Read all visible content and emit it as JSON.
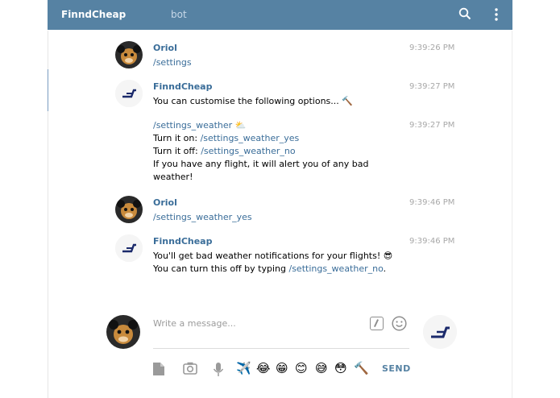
{
  "header": {
    "title": "FinndCheap",
    "subtitle": "bot",
    "search_icon": "search-icon",
    "more_icon": "more-vertical-icon",
    "color": "#5682a3"
  },
  "messages": [
    {
      "author": "Oriol",
      "time": "9:39:26 PM",
      "lines": [
        "/settings"
      ]
    },
    {
      "author": "FinndCheap",
      "time": "9:39:27 PM",
      "text": "You can customise the following options...",
      "emoji": "🔨"
    },
    {
      "time": "9:39:27 PM",
      "command": "/settings_weather",
      "command_emoji": "⛅",
      "turn_on_label": "Turn it on:",
      "turn_on_cmd": "/settings_weather_yes",
      "turn_off_label": "Turn it off:",
      "turn_off_cmd": "/settings_weather_no",
      "note_line1": "If you have any flight, it will alert you of any bad",
      "note_line2": "weather!"
    },
    {
      "author": "Oriol",
      "time": "9:39:46 PM",
      "lines": [
        "/settings_weather_yes"
      ]
    },
    {
      "author": "FinndCheap",
      "time": "9:39:46 PM",
      "line1": "You'll get bad weather notifications for your flights!",
      "line1_emoji": "😎",
      "line2_prefix": "You can turn this off by typing",
      "line2_cmd": "/settings_weather_no",
      "line2_suffix": "."
    }
  ],
  "composer": {
    "placeholder": "Write a message...",
    "send_label": "SEND",
    "quick_emojis": [
      "✈️",
      "😂",
      "😁",
      "😊",
      "😅",
      "😳",
      "🔨"
    ]
  }
}
